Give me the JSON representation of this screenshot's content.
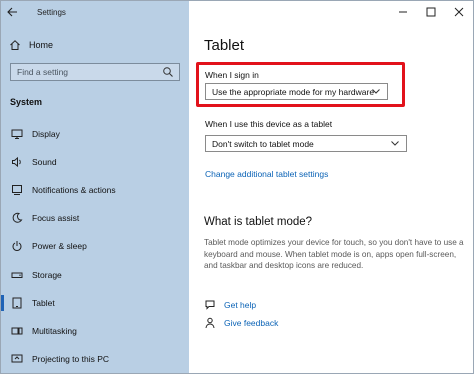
{
  "titlebar": {
    "app_title": "Settings"
  },
  "sidebar": {
    "home_label": "Home",
    "search_placeholder": "Find a setting",
    "section_title": "System",
    "items": [
      {
        "label": "Display",
        "icon": "monitor-icon"
      },
      {
        "label": "Sound",
        "icon": "speaker-icon"
      },
      {
        "label": "Notifications & actions",
        "icon": "notifications-icon"
      },
      {
        "label": "Focus assist",
        "icon": "moon-icon"
      },
      {
        "label": "Power & sleep",
        "icon": "power-icon"
      },
      {
        "label": "Storage",
        "icon": "storage-icon"
      },
      {
        "label": "Tablet",
        "icon": "tablet-icon",
        "selected": true
      },
      {
        "label": "Multitasking",
        "icon": "multitasking-icon"
      },
      {
        "label": "Projecting to this PC",
        "icon": "projecting-icon"
      }
    ]
  },
  "main": {
    "title": "Tablet",
    "signin_label": "When I sign in",
    "signin_value": "Use the appropriate mode for my hardware",
    "device_label": "When I use this device as a tablet",
    "device_value": "Don't switch to tablet mode",
    "change_link": "Change additional tablet settings",
    "section_heading": "What is tablet mode?",
    "description": "Tablet mode optimizes your device for touch, so you don't have to use a keyboard and mouse. When tablet mode is on, apps open full-screen, and taskbar and desktop icons are reduced.",
    "get_help": "Get help",
    "give_feedback": "Give feedback"
  },
  "colors": {
    "sidebar_bg": "#b9cfe4",
    "accent": "#0b63b6",
    "highlight_border": "#e2121b"
  }
}
